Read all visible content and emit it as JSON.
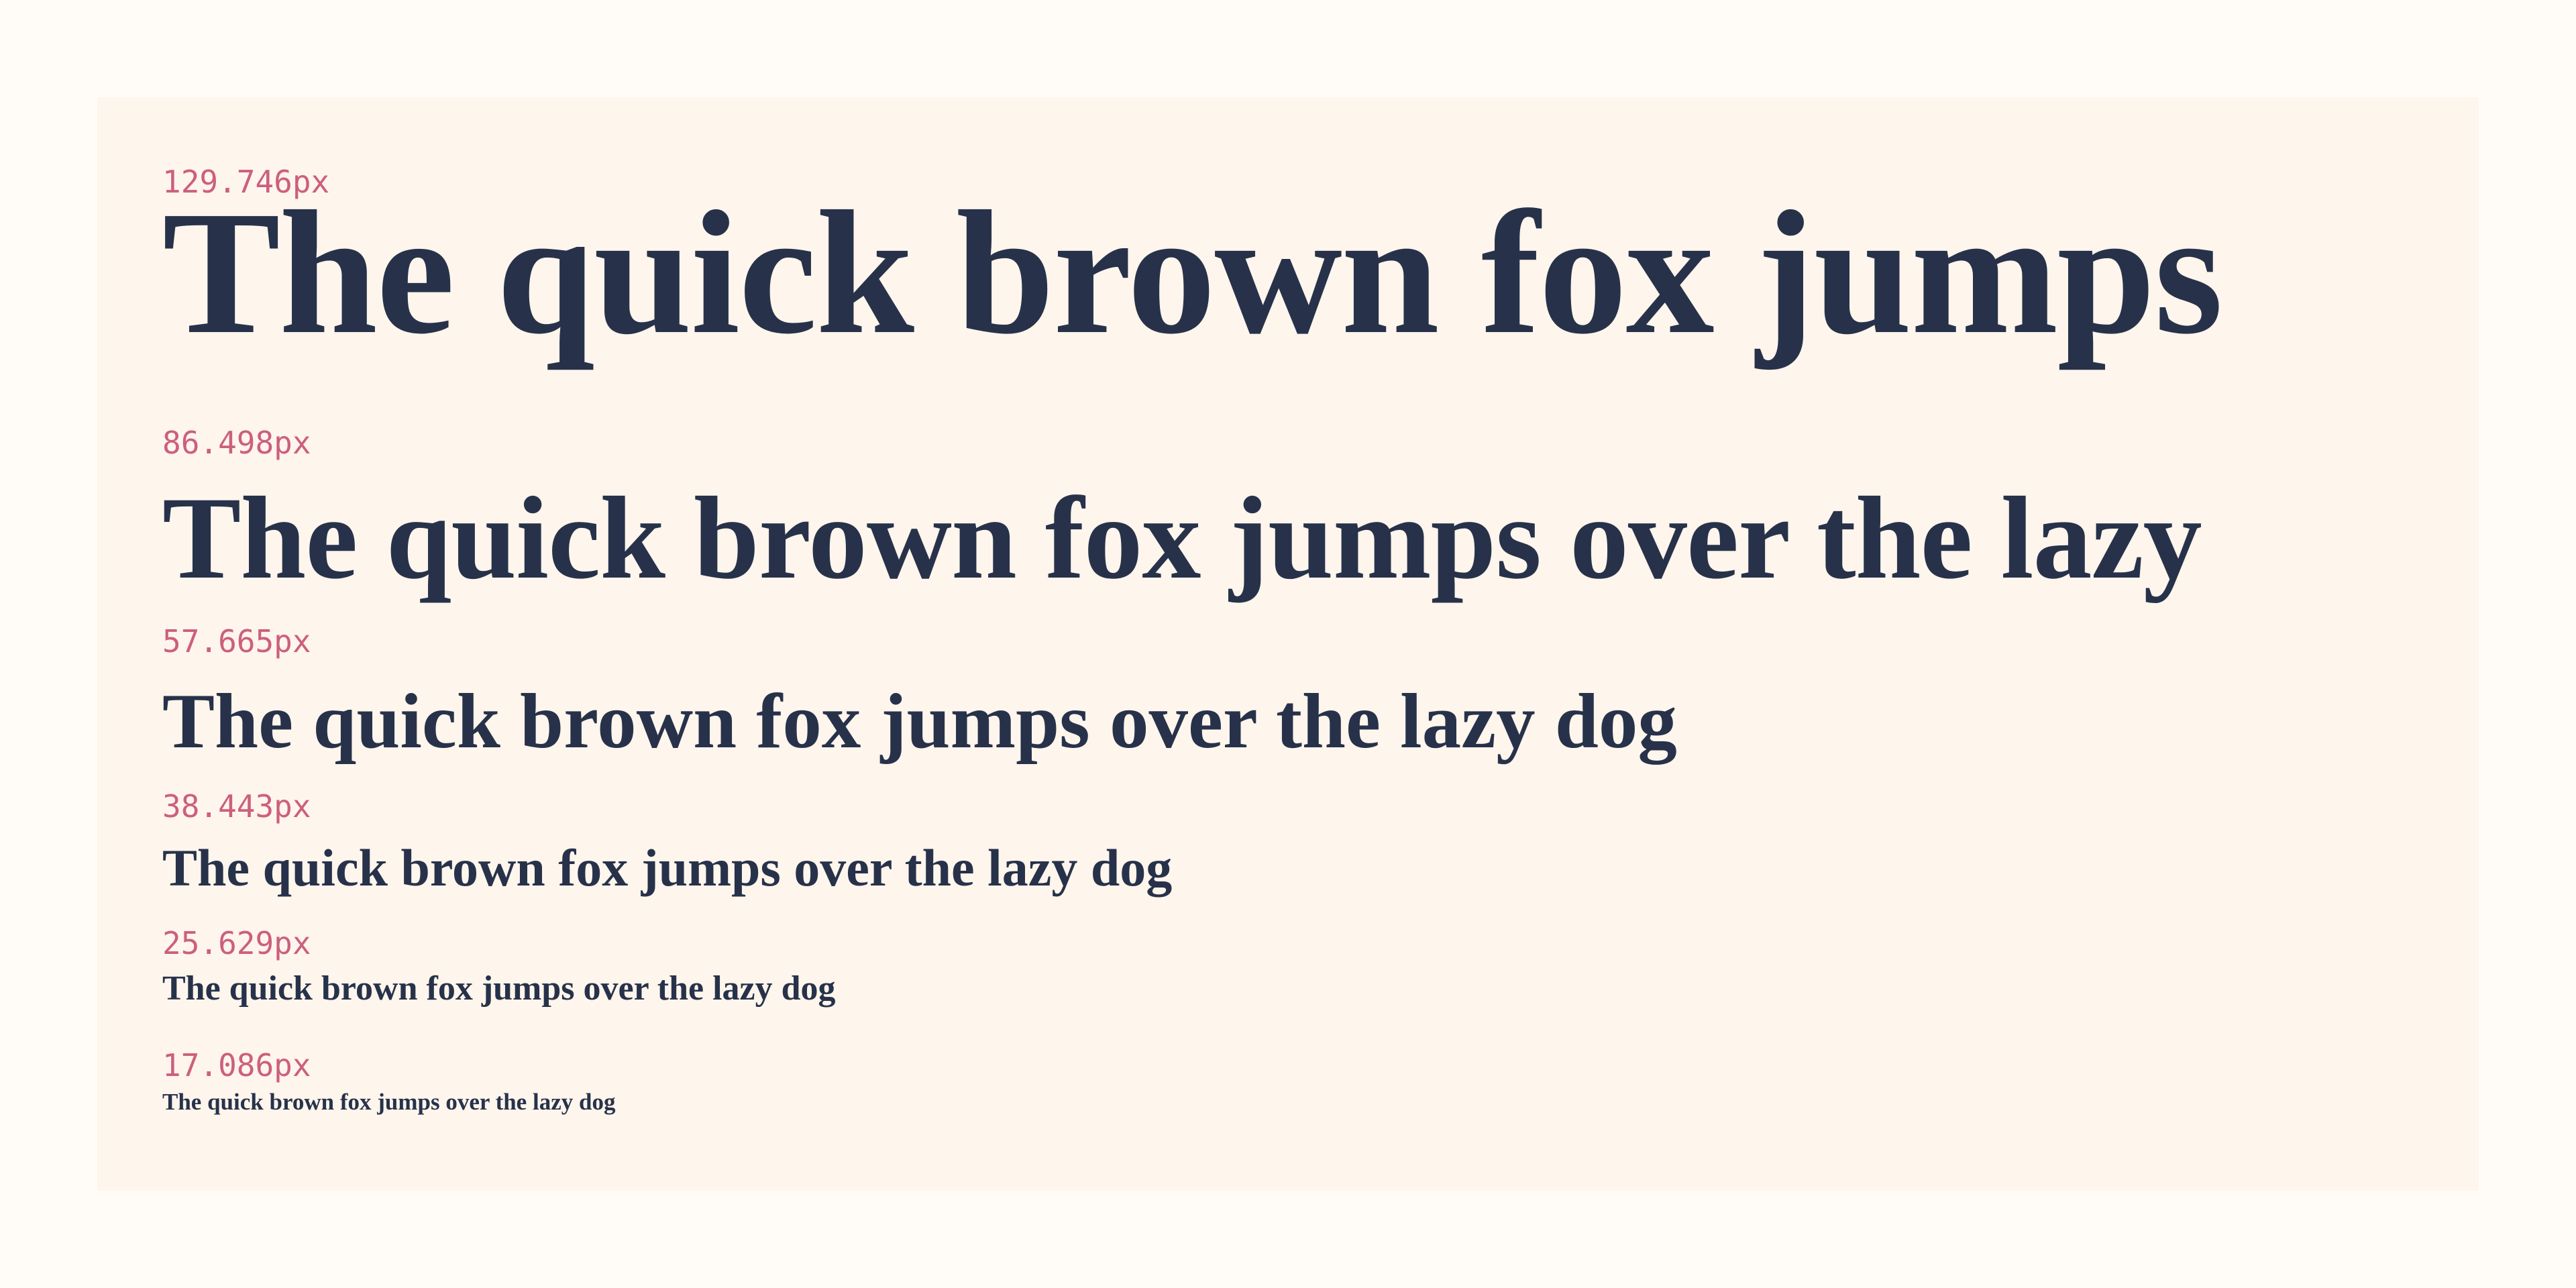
{
  "specimens": [
    {
      "label": "129.746px",
      "text": "The quick brown fox jumps"
    },
    {
      "label": "86.498px",
      "text": "The quick brown fox jumps over the lazy"
    },
    {
      "label": "57.665px",
      "text": "The quick brown fox jumps over the lazy dog"
    },
    {
      "label": "38.443px",
      "text": "The quick brown fox jumps over the lazy dog"
    },
    {
      "label": "25.629px",
      "text": "The quick brown fox jumps over the lazy dog"
    },
    {
      "label": "17.086px",
      "text": "The quick brown fox jumps over the lazy dog"
    }
  ],
  "colors": {
    "page_background": "#fffcf8",
    "panel_background": "#fef5ec",
    "label": "#cc5f7e",
    "specimen_text": "#27324a"
  }
}
